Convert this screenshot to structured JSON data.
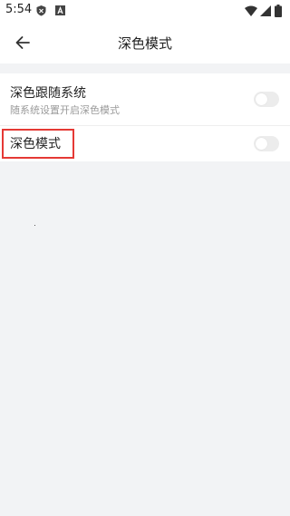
{
  "status_bar": {
    "time": "5:54",
    "icons": [
      "shield-icon",
      "a-icon",
      "wifi-icon",
      "signal-icon",
      "battery-icon"
    ]
  },
  "header": {
    "title": "深色模式",
    "back_icon": "arrow-left-icon"
  },
  "settings": {
    "follow_system": {
      "title": "深色跟随系统",
      "subtitle": "随系统设置开启深色模式",
      "enabled": false
    },
    "dark_mode": {
      "title": "深色模式",
      "enabled": false
    }
  },
  "colors": {
    "background": "#f2f3f5",
    "surface": "#ffffff",
    "toggle_off": "#ececec",
    "highlight": "#e53935"
  }
}
